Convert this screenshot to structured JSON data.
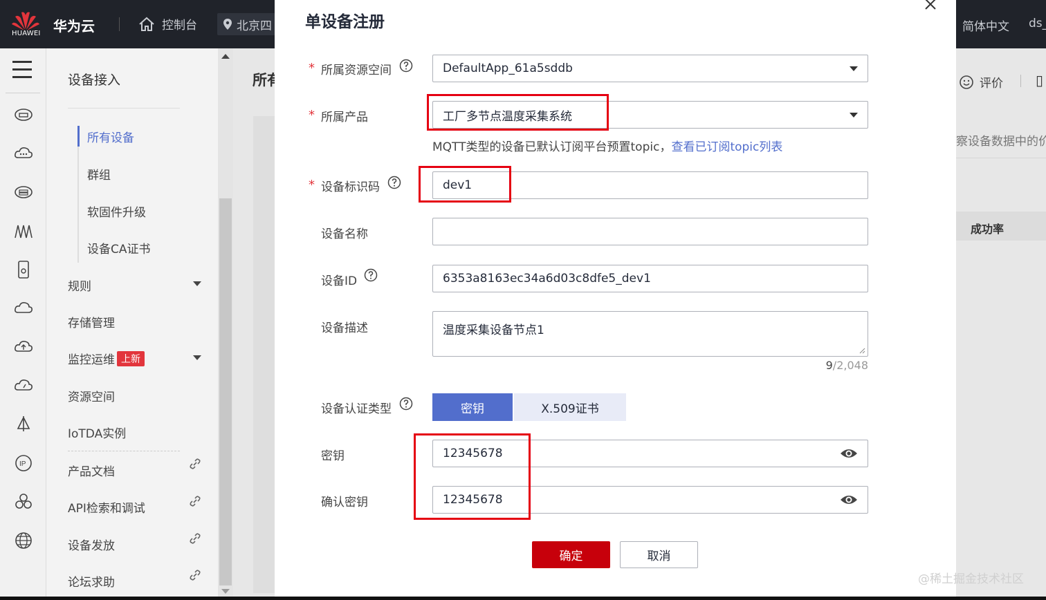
{
  "topbar": {
    "logo_text": "HUAWEI",
    "brand": "华为云",
    "console": "控制台",
    "region": "北京四",
    "language": "简体中文",
    "user": "ds_"
  },
  "subnav": {
    "title": "设备接入",
    "children": [
      "所有设备",
      "群组",
      "软固件升级",
      "设备CA证书"
    ],
    "items": {
      "rules": "规则",
      "storage": "存储管理",
      "monitor": "监控运维",
      "monitor_badge": "上新",
      "resource_space": "资源空间",
      "iotda": "IoTDA实例",
      "product_docs": "产品文档",
      "api": "API检索和调试",
      "provisioning": "设备发放",
      "forum": "论坛求助"
    }
  },
  "background": {
    "page_title": "所有",
    "eval": "评价",
    "desc_snippet": "察设备数据中的价",
    "column_header": "成功率",
    "watermark": "@稀土掘金技术社区"
  },
  "modal": {
    "title": "单设备注册",
    "fields": {
      "resource_space": {
        "label": "所属资源空间",
        "value": "DefaultApp_61a5sddb"
      },
      "product": {
        "label": "所属产品",
        "value": "工厂多节点温度采集系统"
      },
      "hint_text": "MQTT类型的设备已默认订阅平台预置topic，",
      "hint_link": "查看已订阅topic列表",
      "node_id": {
        "label": "设备标识码",
        "value": "dev1"
      },
      "device_name": {
        "label": "设备名称",
        "value": ""
      },
      "device_id": {
        "label": "设备ID",
        "value": "6353a8163ec34a6d03c8dfe5_dev1"
      },
      "description": {
        "label": "设备描述",
        "value": "温度采集设备节点1"
      },
      "counter_used": "9",
      "counter_total": "/2,048",
      "auth_type": {
        "label": "设备认证类型",
        "options": [
          "密钥",
          "X.509证书"
        ],
        "selected": "密钥"
      },
      "secret": {
        "label": "密钥",
        "value": "12345678"
      },
      "confirm_secret": {
        "label": "确认密钥",
        "value": "12345678"
      }
    },
    "buttons": {
      "ok": "确定",
      "cancel": "取消"
    }
  },
  "colors": {
    "primary": "#526ecc",
    "confirm": "#c7000b",
    "annotation": "#e50012",
    "topbar": "#20232a"
  }
}
